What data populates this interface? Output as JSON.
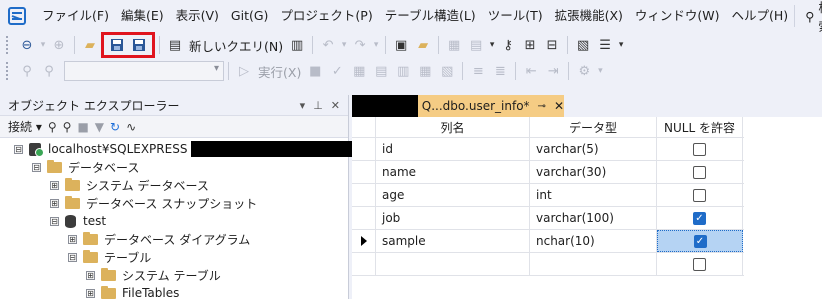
{
  "menu": {
    "items": [
      "ファイル(F)",
      "編集(E)",
      "表示(V)",
      "Git(G)",
      "プロジェクト(P)",
      "テーブル構造(L)",
      "ツール(T)",
      "拡張機能(X)",
      "ウィンドウ(W)",
      "ヘルプ(H)"
    ],
    "search_label": "検索"
  },
  "toolbar": {
    "new_query_label": "新しいクエリ(N)",
    "execute_label": "実行(X)",
    "database_combo_value": ""
  },
  "object_explorer": {
    "title": "オブジェクト エクスプローラー",
    "connect_label": "接続",
    "tree": [
      {
        "label": "localhost¥SQLEXPRESS",
        "expander": "⊟"
      },
      {
        "label": "データベース",
        "expander": "⊟"
      },
      {
        "label": "システム データベース",
        "expander": "⊞"
      },
      {
        "label": "データベース スナップショット",
        "expander": "⊞"
      },
      {
        "label": "test",
        "expander": "⊟"
      },
      {
        "label": "データベース ダイアグラム",
        "expander": "⊞"
      },
      {
        "label": "テーブル",
        "expander": "⊟"
      },
      {
        "label": "システム テーブル",
        "expander": "⊞"
      },
      {
        "label": "FileTables",
        "expander": "⊞"
      }
    ]
  },
  "document": {
    "tab_title": "Q...dbo.user_info*",
    "columns_header": [
      "列名",
      "データ型",
      "NULL を許容"
    ],
    "rows": [
      {
        "name": "id",
        "type": "varchar(5)",
        "allow_null": false
      },
      {
        "name": "name",
        "type": "varchar(30)",
        "allow_null": false
      },
      {
        "name": "age",
        "type": "int",
        "allow_null": false
      },
      {
        "name": "job",
        "type": "varchar(100)",
        "allow_null": true
      },
      {
        "name": "sample",
        "type": "nchar(10)",
        "allow_null": true
      },
      {
        "name": "",
        "type": "",
        "allow_null": false
      }
    ]
  },
  "colors": {
    "accent": "#1f6cc8",
    "tab_active": "#f5cc84",
    "highlight_box": "#e0141e",
    "selected_cell": "#b5d3f3"
  }
}
